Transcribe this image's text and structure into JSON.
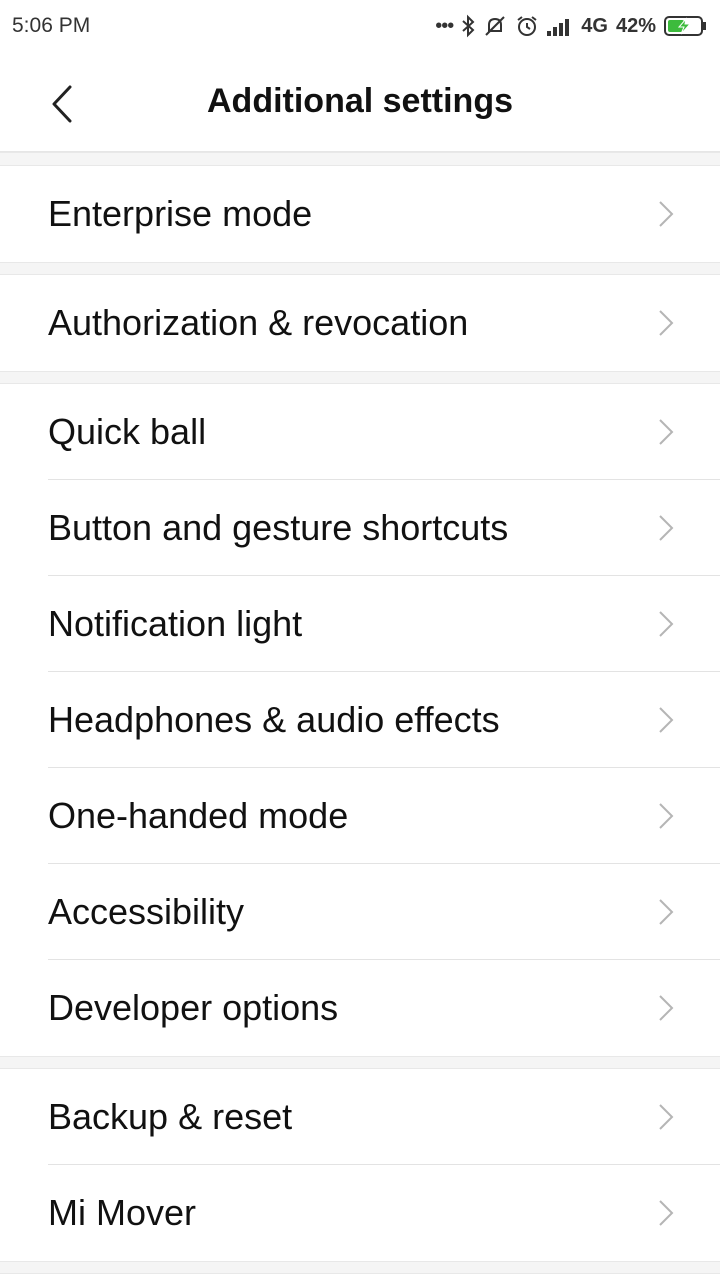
{
  "status": {
    "time": "5:06 PM",
    "dots": "•••",
    "network": "4G",
    "battery": "42%"
  },
  "header": {
    "title": "Additional settings"
  },
  "groups": [
    {
      "items": [
        "Enterprise mode"
      ]
    },
    {
      "items": [
        "Authorization & revocation"
      ]
    },
    {
      "items": [
        "Quick ball",
        "Button and gesture shortcuts",
        "Notification light",
        "Headphones & audio effects",
        "One-handed mode",
        "Accessibility",
        "Developer options"
      ]
    },
    {
      "items": [
        "Backup & reset",
        "Mi Mover"
      ]
    }
  ],
  "colors": {
    "accent_battery": "#3dbb3d",
    "chevron": "#b5b5b5",
    "separator": "#f5f5f5"
  }
}
